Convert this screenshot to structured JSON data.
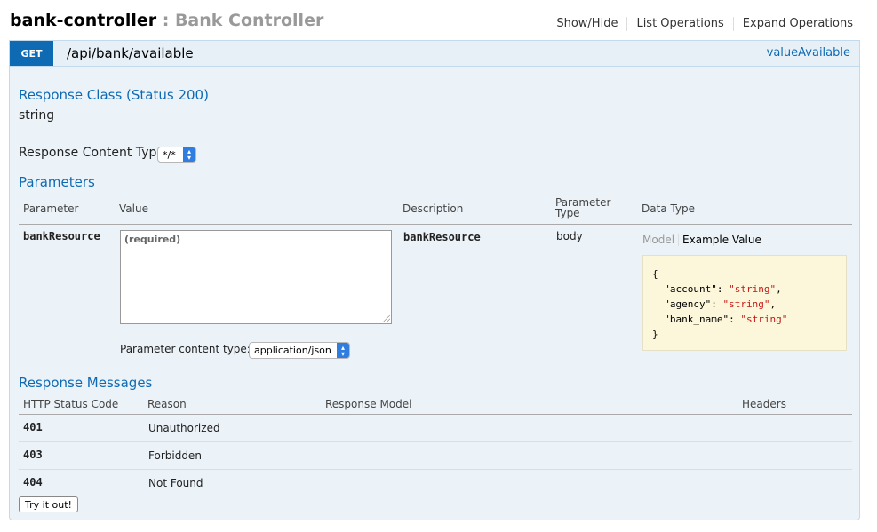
{
  "controller": {
    "name": "bank-controller",
    "separator": " : ",
    "description": "Bank Controller",
    "links": [
      "Show/Hide",
      "List Operations",
      "Expand Operations"
    ]
  },
  "operation": {
    "method": "GET",
    "path": "/api/bank/available",
    "nickname": "valueAvailable",
    "response_class_heading": "Response Class (Status 200)",
    "response_class_value": "string",
    "response_content_type_label": "Response Content Type",
    "response_content_type_value": "*/*",
    "parameters_heading": "Parameters",
    "param_headers": {
      "parameter": "Parameter",
      "value": "Value",
      "description": "Description",
      "parameter_type_1": "Parameter",
      "parameter_type_2": "Type",
      "data_type": "Data Type"
    },
    "parameter": {
      "name": "bankResource",
      "placeholder": "(required)",
      "description": "bankResource",
      "type": "body",
      "model_tab": "Model",
      "example_tab": "Example Value",
      "example_lines": [
        {
          "key": "\"account\"",
          "value": "\"string\"",
          "comma": ","
        },
        {
          "key": "\"agency\"",
          "value": "\"string\"",
          "comma": ","
        },
        {
          "key": "\"bank_name\"",
          "value": "\"string\"",
          "comma": ""
        }
      ],
      "content_type_label": "Parameter content type:",
      "content_type_value": "application/json"
    },
    "response_messages_heading": "Response Messages",
    "response_headers": {
      "status": "HTTP Status Code",
      "reason": "Reason",
      "model": "Response Model",
      "headers": "Headers"
    },
    "responses": [
      {
        "code": "401",
        "reason": "Unauthorized"
      },
      {
        "code": "403",
        "reason": "Forbidden"
      },
      {
        "code": "404",
        "reason": "Not Found"
      }
    ],
    "try_button": "Try it out!"
  }
}
